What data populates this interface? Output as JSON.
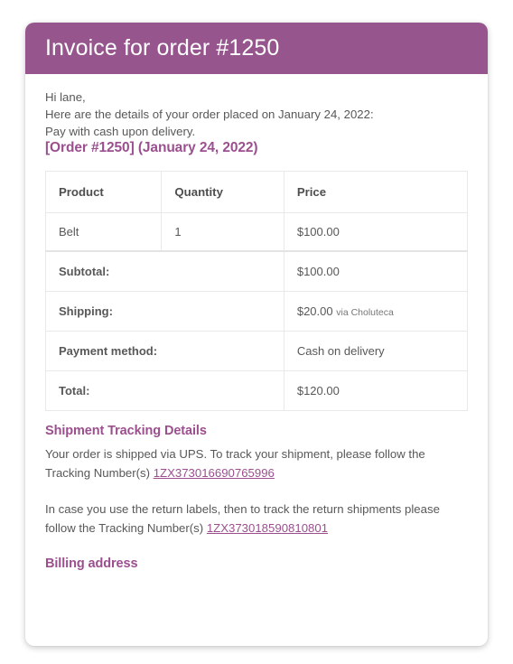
{
  "header": {
    "title": "Invoice for order #1250"
  },
  "body": {
    "greeting": "Hi lane,",
    "details_line": "Here are the details of your order placed on January 24, 2022:",
    "payment_line": "Pay with cash upon delivery.",
    "order_heading": "[Order #1250] (January 24, 2022)"
  },
  "table": {
    "columns": [
      "Product",
      "Quantity",
      "Price"
    ],
    "items": [
      {
        "product": "Belt",
        "quantity": "1",
        "price": "$100.00"
      }
    ],
    "summary": [
      {
        "label": "Subtotal:",
        "value": "$100.00",
        "note": ""
      },
      {
        "label": "Shipping:",
        "value": "$20.00",
        "note": "via Choluteca"
      },
      {
        "label": "Payment method:",
        "value": "Cash on delivery",
        "note": ""
      },
      {
        "label": "Total:",
        "value": "$120.00",
        "note": ""
      }
    ]
  },
  "tracking": {
    "heading": "Shipment Tracking Details",
    "line1_before": "Your order is shipped via UPS. To track your shipment, please follow the Tracking Number(s) ",
    "link1": "1ZX373016690765996",
    "line2_before": "In case you use the return labels, then to track the return shipments please follow the Tracking Number(s) ",
    "link2": "1ZX373018590810801"
  },
  "billing": {
    "heading": "Billing address"
  },
  "colors": {
    "header_bg": "#96568D",
    "accent": "#9B4F8E",
    "body_text": "#585858",
    "border": "#e9e9e9",
    "card_bg": "#ffffff",
    "page_bg": "#ffffff"
  }
}
